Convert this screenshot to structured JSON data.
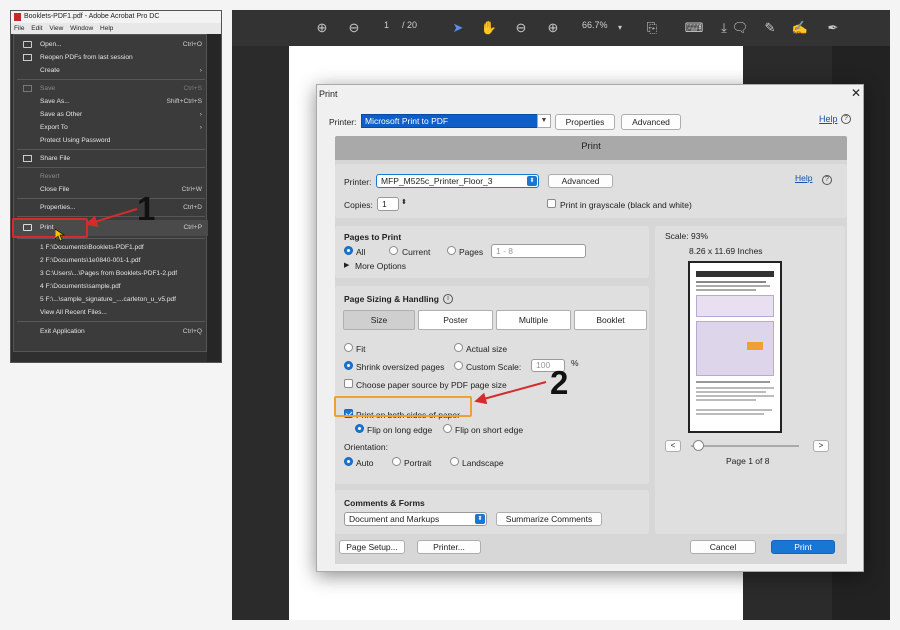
{
  "menu": {
    "app_title": "Booklets-PDF1.pdf - Adobe Acrobat Pro DC",
    "menubar": [
      "File",
      "Edit",
      "View",
      "Window",
      "Help"
    ],
    "items": [
      {
        "label": "Open...",
        "shortcut": "Ctrl+O",
        "disabled": false
      },
      {
        "label": "Reopen PDFs from last session",
        "shortcut": "",
        "disabled": false
      },
      {
        "label": "Create",
        "shortcut": "›",
        "disabled": false
      },
      {
        "label": "Save",
        "shortcut": "Ctrl+S",
        "disabled": true
      },
      {
        "label": "Save As...",
        "shortcut": "Shift+Ctrl+S",
        "disabled": false
      },
      {
        "label": "Save as Other",
        "shortcut": "›",
        "disabled": false
      },
      {
        "label": "Export To",
        "shortcut": "›",
        "disabled": false
      },
      {
        "label": "Protect Using Password",
        "shortcut": "",
        "disabled": false
      },
      {
        "label": "Share File",
        "shortcut": "",
        "disabled": false
      },
      {
        "label": "Revert",
        "shortcut": "",
        "disabled": true
      },
      {
        "label": "Close File",
        "shortcut": "Ctrl+W",
        "disabled": false
      },
      {
        "label": "Properties...",
        "shortcut": "Ctrl+D",
        "disabled": false
      },
      {
        "label": "Print",
        "shortcut": "Ctrl+P",
        "disabled": false
      },
      {
        "label": "1 F:\\Documents\\Booklets-PDF1.pdf",
        "shortcut": "",
        "disabled": false
      },
      {
        "label": "2 F:\\Documents\\1e0840-001-1.pdf",
        "shortcut": "",
        "disabled": false
      },
      {
        "label": "3 C:\\Users\\...\\Pages from Booklets-PDF1-2.pdf",
        "shortcut": "",
        "disabled": false
      },
      {
        "label": "4 F:\\Documents\\sample.pdf",
        "shortcut": "",
        "disabled": false
      },
      {
        "label": "5 F:\\...\\sample_signature_....carleton_u_v5.pdf",
        "shortcut": "",
        "disabled": false
      },
      {
        "label": "View All Recent Files...",
        "shortcut": "",
        "disabled": false
      },
      {
        "label": "Exit Application",
        "shortcut": "Ctrl+Q",
        "disabled": false
      }
    ]
  },
  "annotations": {
    "step1": "1",
    "step2": "2"
  },
  "viewer": {
    "page_current": "1",
    "page_total": "/ 20",
    "zoom": "66.7%"
  },
  "dialog": {
    "title": "Print",
    "printer_label": "Printer:",
    "printer_value": "Microsoft Print to PDF",
    "properties_btn": "Properties",
    "advanced_btn": "Advanced",
    "help": "Help",
    "inner": {
      "title": "Print",
      "printer_label": "Printer:",
      "printer_value": "MFP_M525c_Printer_Floor_3",
      "advanced_btn": "Advanced",
      "help": "Help",
      "copies_label": "Copies:",
      "copies_value": "1",
      "grayscale_label": "Print in grayscale (black and white)",
      "pages_to_print": {
        "heading": "Pages to Print",
        "all": "All",
        "current": "Current",
        "pages": "Pages",
        "pages_placeholder": "1 - 8",
        "more_options": "More Options"
      },
      "sizing": {
        "heading": "Page Sizing & Handling",
        "tabs": [
          "Size",
          "Poster",
          "Multiple",
          "Booklet"
        ],
        "fit": "Fit",
        "actual_size": "Actual size",
        "shrink": "Shrink oversized pages",
        "custom_scale": "Custom Scale:",
        "custom_scale_value": "100",
        "percent": "%",
        "choose_source": "Choose paper source by PDF page size",
        "both_sides": "Print on both sides of paper",
        "flip_long": "Flip on long edge",
        "flip_short": "Flip on short edge",
        "orientation_label": "Orientation:",
        "auto": "Auto",
        "portrait": "Portrait",
        "landscape": "Landscape"
      },
      "comments": {
        "heading": "Comments & Forms",
        "select_value": "Document and Markups",
        "summarize_btn": "Summarize Comments"
      },
      "preview": {
        "scale": "Scale:  93%",
        "size": "8.26 x 11.69 Inches",
        "page_of": "Page 1 of 8",
        "prev": "<",
        "next": ">"
      },
      "page_setup_btn": "Page Setup...",
      "printer_btn": "Printer...",
      "cancel_btn": "Cancel",
      "print_btn": "Print"
    }
  },
  "colors": {
    "accent": "#1976d2",
    "callout_red": "#d62b2b",
    "callout_orange": "#f0a032"
  }
}
